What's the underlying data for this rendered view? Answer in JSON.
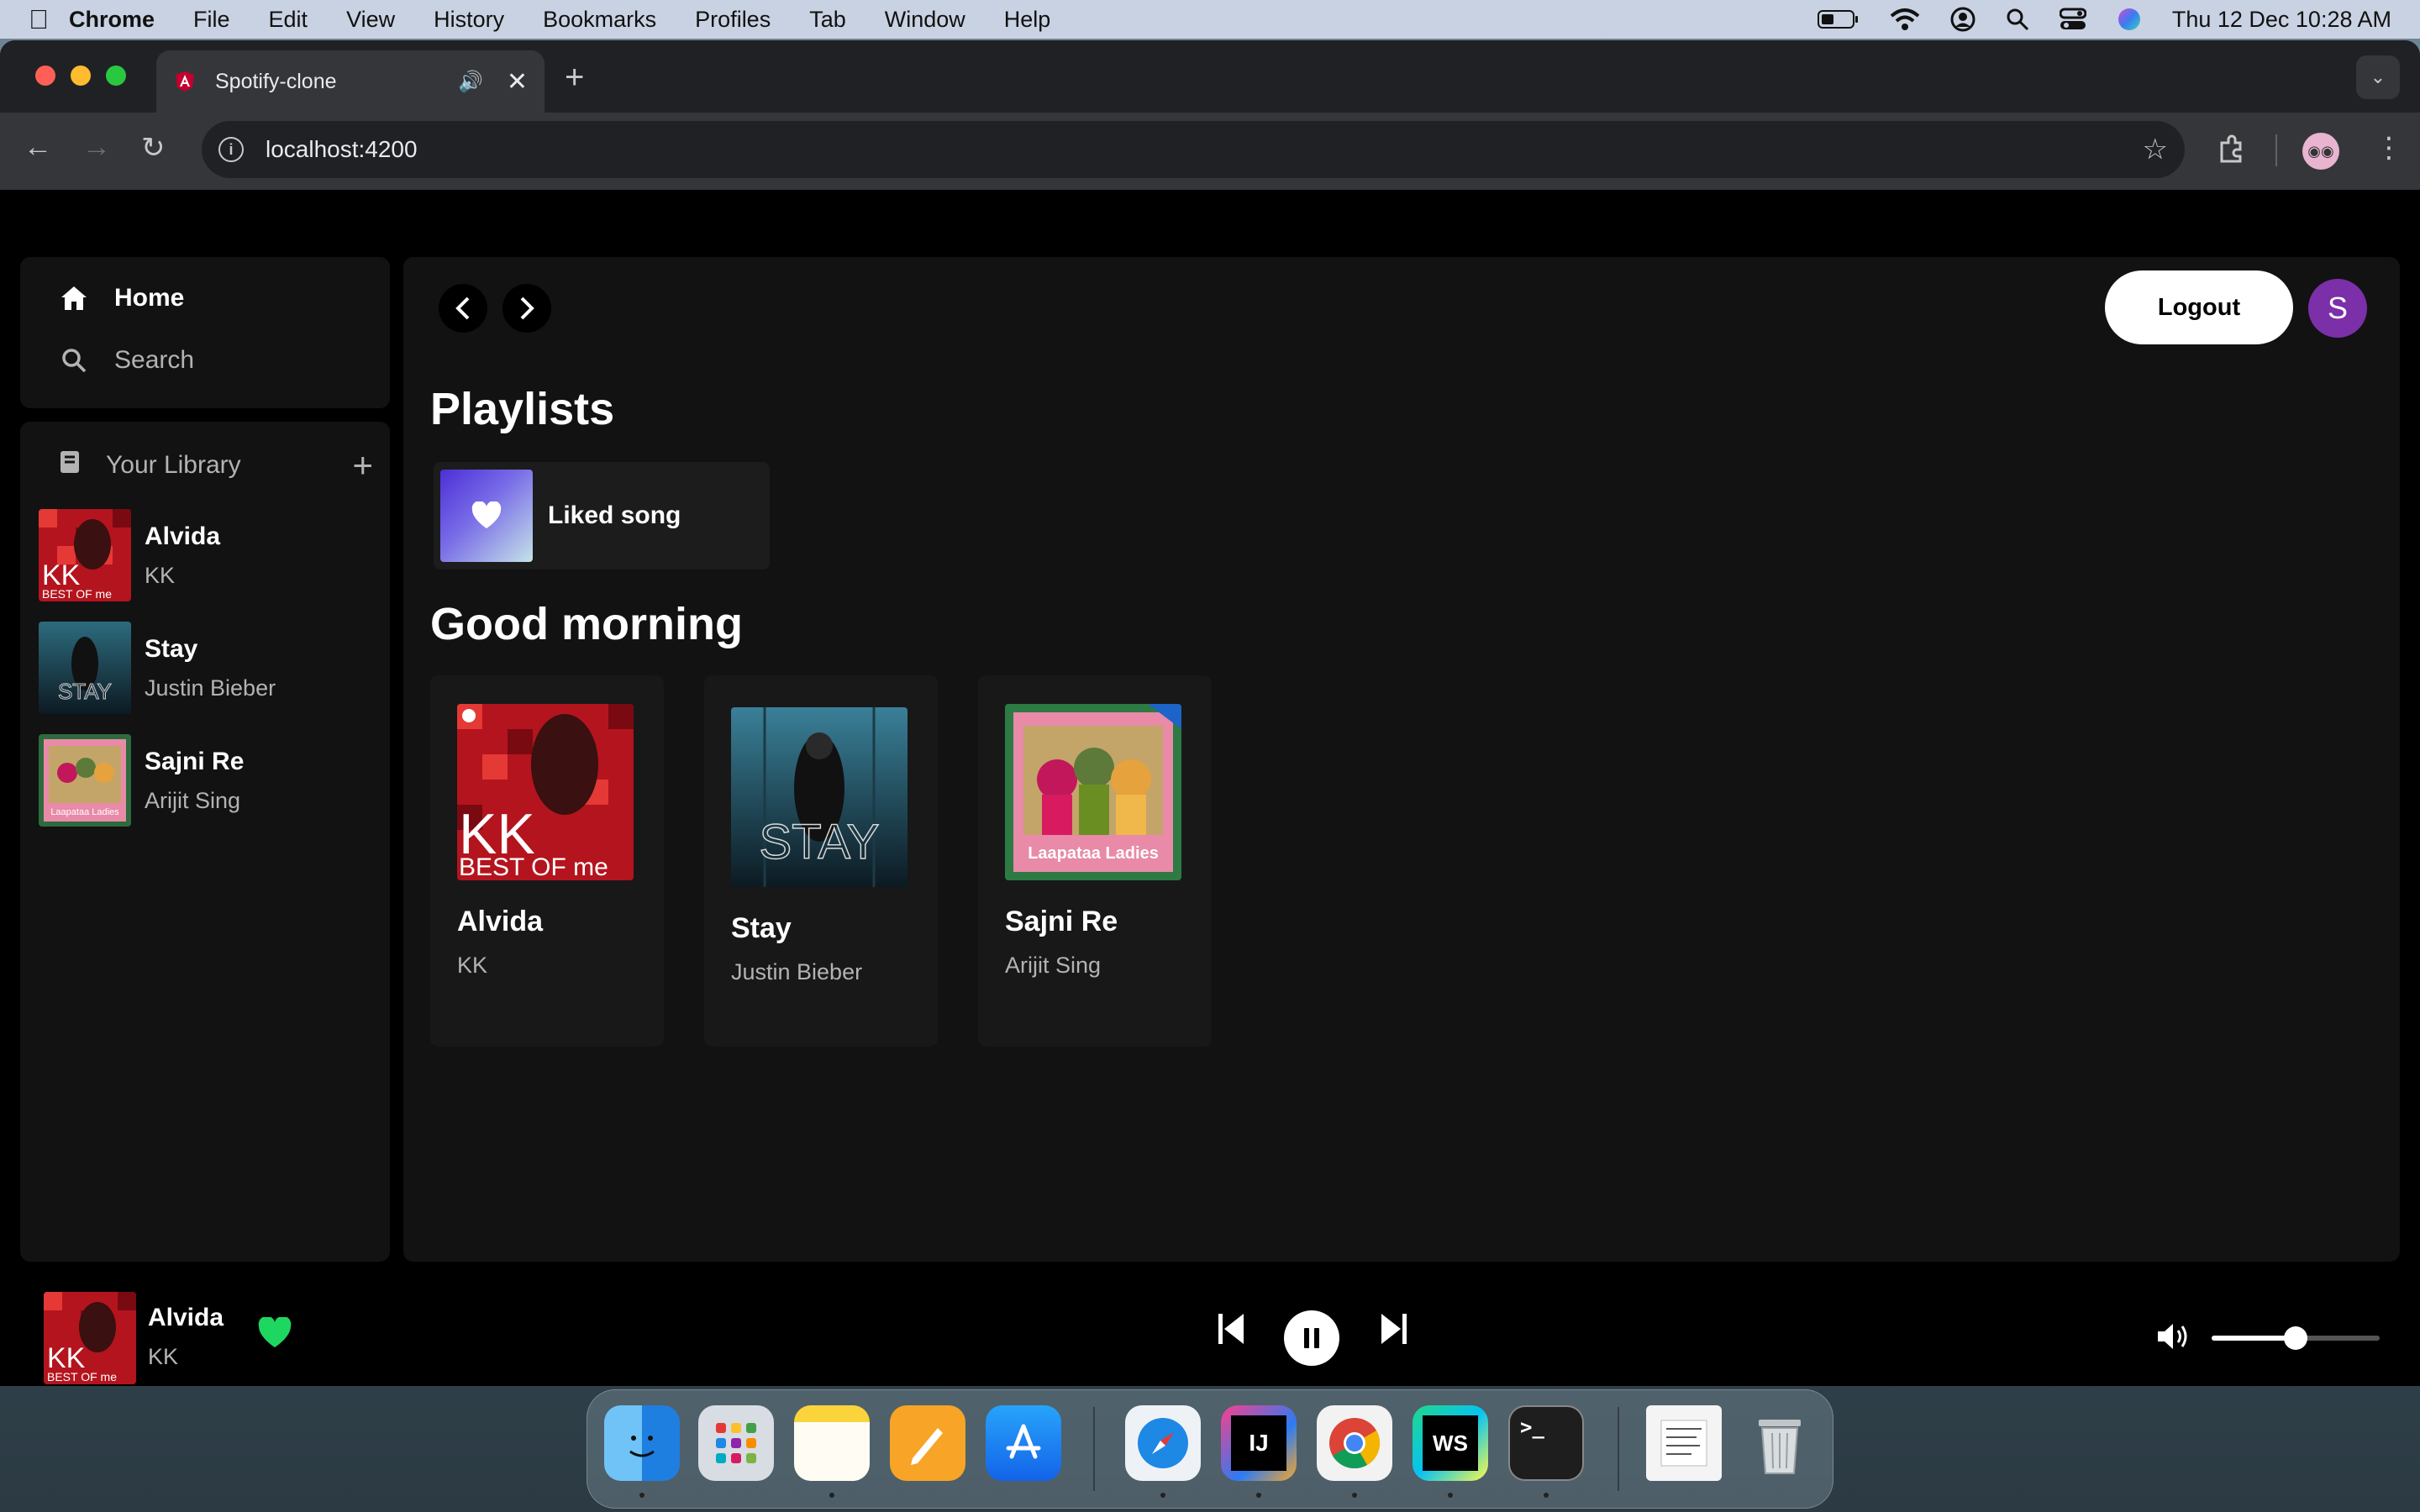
{
  "menubar": {
    "app": "Chrome",
    "items": [
      "File",
      "Edit",
      "View",
      "History",
      "Bookmarks",
      "Profiles",
      "Tab",
      "Window",
      "Help"
    ],
    "clock": "Thu 12 Dec  10:28 AM"
  },
  "browser": {
    "tab_title": "Spotify-clone",
    "url": "localhost:4200"
  },
  "sidebar": {
    "home": "Home",
    "search": "Search",
    "library_title": "Your Library",
    "library": [
      {
        "title": "Alvida",
        "artist": "KK"
      },
      {
        "title": "Stay",
        "artist": "Justin Bieber"
      },
      {
        "title": "Sajni Re",
        "artist": "Arijit Sing"
      }
    ]
  },
  "main": {
    "logout_label": "Logout",
    "avatar_letter": "S",
    "playlists_heading": "Playlists",
    "liked_label": "Liked song",
    "greeting": "Good morning",
    "cards": [
      {
        "title": "Alvida",
        "artist": "KK"
      },
      {
        "title": "Stay",
        "artist": "Justin Bieber"
      },
      {
        "title": "Sajni Re",
        "artist": "Arijit Sing"
      }
    ],
    "art_text": {
      "kk_top": "KK",
      "kk_bottom": "BEST OF me",
      "stay": "STAY",
      "laapataa": "Laapataa Ladies"
    }
  },
  "player": {
    "title": "Alvida",
    "artist": "KK",
    "volume": 0.5
  },
  "dock": {
    "intellij": "IJ",
    "webstorm": "WS",
    "terminal": ">_"
  },
  "colors": {
    "accent_green": "#1ed760",
    "avatar_purple": "#7b2fa8"
  }
}
